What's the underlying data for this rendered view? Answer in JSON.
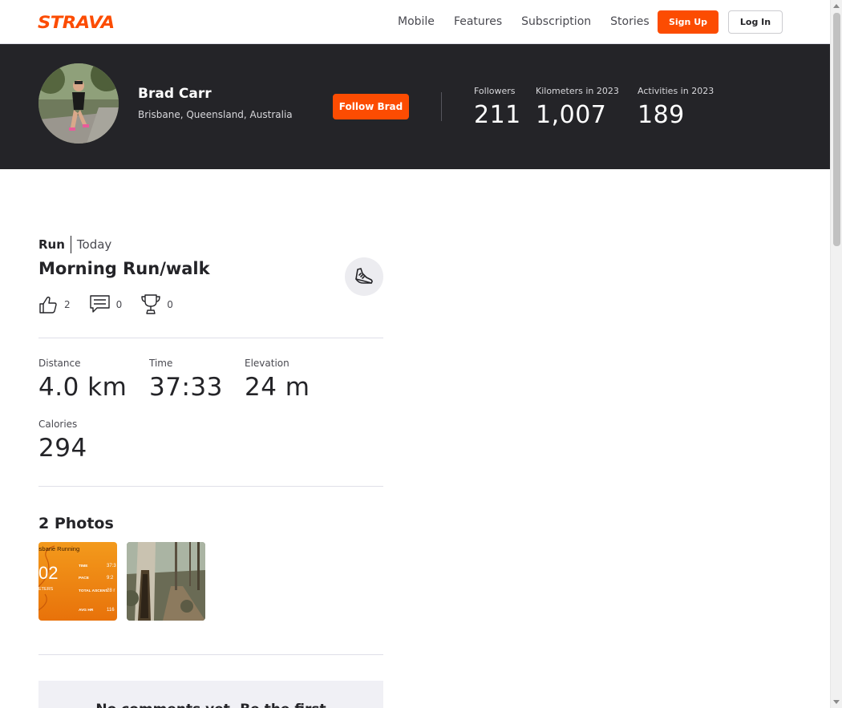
{
  "nav": {
    "logo": "STRAVA",
    "links": [
      "Mobile",
      "Features",
      "Subscription",
      "Stories"
    ],
    "signup": "Sign Up",
    "login": "Log In"
  },
  "athlete": {
    "name": "Brad Carr",
    "location": "Brisbane, Queensland, Australia",
    "follow_label": "Follow Brad",
    "stats": [
      {
        "label": "Followers",
        "value": "211"
      },
      {
        "label": "Kilometers in 2023",
        "value": "1,007"
      },
      {
        "label": "Activities in 2023",
        "value": "189"
      }
    ]
  },
  "activity": {
    "type": "Run",
    "date": "Today",
    "title": "Morning Run/walk",
    "kudos": "2",
    "comments": "0",
    "achievements": "0",
    "metrics": [
      {
        "label": "Distance",
        "value": "4.0 km"
      },
      {
        "label": "Time",
        "value": "37:33"
      },
      {
        "label": "Elevation",
        "value": "24 m"
      },
      {
        "label": "Calories",
        "value": "294"
      }
    ],
    "photos_title": "2 Photos",
    "photo1": {
      "header": "isbane Running",
      "big": "02",
      "unit": "ETERS",
      "rows": [
        {
          "k": "TIME",
          "v": "37:3"
        },
        {
          "k": "PACE",
          "v": "9:2"
        },
        {
          "k": "TOTAL ASCENT",
          "v": "28 r"
        },
        {
          "k": "AVG HR",
          "v": "116"
        }
      ]
    },
    "comments_empty": "No comments yet. Be the first"
  },
  "colors": {
    "brand": "#fc4c02",
    "header_bg": "#242428"
  }
}
